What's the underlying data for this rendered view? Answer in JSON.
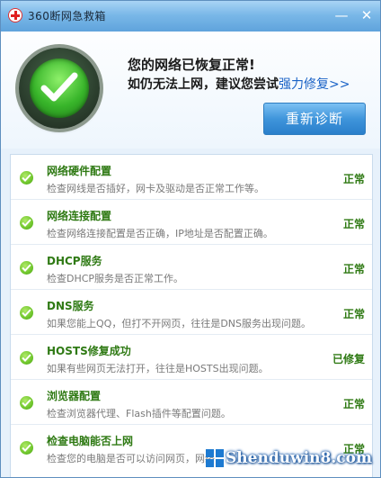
{
  "window": {
    "title": "360断网急救箱"
  },
  "title_buttons": {
    "minimize": "—",
    "close": "✕"
  },
  "header": {
    "headline": "您的网络已恢复正常!",
    "subline_prefix": "如仍无法上网，建议您尝试",
    "repair_link": "强力修复>>",
    "rediagnose_button": "重新诊断"
  },
  "items": [
    {
      "title": "网络硬件配置",
      "desc": "检查网线是否插好，网卡及驱动是否正常工作等。",
      "status": "正常"
    },
    {
      "title": "网络连接配置",
      "desc": "检查网络连接配置是否正确，IP地址是否配置正确。",
      "status": "正常"
    },
    {
      "title": "DHCP服务",
      "desc": "检查DHCP服务是否正常工作。",
      "status": "正常"
    },
    {
      "title": "DNS服务",
      "desc": "如果您能上QQ，但打不开网页，往往是DNS服务出现问题。",
      "status": "正常"
    },
    {
      "title": "HOSTS修复成功",
      "desc": "如果有些网页无法打开，往往是HOSTS出现问题。",
      "status": "已修复"
    },
    {
      "title": "浏览器配置",
      "desc": "检查浏览器代理、Flash插件等配置问题。",
      "status": "正常"
    },
    {
      "title": "检查电脑能否上网",
      "desc": "检查您的电脑是否可以访问网页，网络",
      "status": "正常"
    }
  ],
  "watermark": {
    "text": "Shenduwin8.com"
  },
  "colors": {
    "accent": "#3f95db",
    "ok_green": "#2f7a14",
    "link": "#1a62c6"
  }
}
